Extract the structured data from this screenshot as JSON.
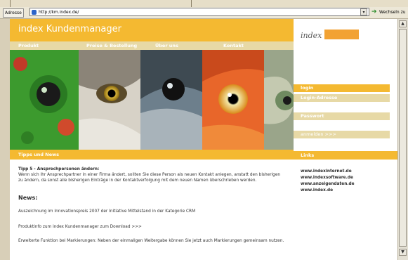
{
  "browser": {
    "address_label": "Adresse",
    "url": "http://km.index.de/",
    "go_label": "Wechseln zu"
  },
  "header": {
    "title": "index Kundenmanager",
    "logo_text": "index"
  },
  "nav": {
    "items": [
      "Produkt",
      "Preise & Bestellung",
      "Über uns",
      "Kontakt"
    ]
  },
  "content": {
    "section_label": "Tipps und News",
    "tip_title": "Tipp 5 - Ansprechpersonen ändern:",
    "tip_body": "Wenn sich Ihr Ansprechpartner in einer Firma ändert, sollten Sie diese Person als neuen Kontakt anlegen, anstatt den bisherigen zu ändern, da sonst alle bisherigen Einträge in der Kontaktverfolgung mit dem neuen Namen überschrieben werden.",
    "news_heading": "News:",
    "news": [
      "Auszeichnung im Innovationspreis 2007 der Initiative Mittelstand in der Kategorie CRM",
      "Produktinfo zum index Kundenmanager zum Download >>>",
      "Erweiterte Funktion bei Markierungen: Neben der einmaligen Weitergabe können Sie jetzt auch Markierungen gemeinsam nutzen."
    ]
  },
  "sidebar": {
    "login_label": "login",
    "login_address_label": "Login-Adresse",
    "password_label": "Passwort",
    "submit_label": "anmelden >>>",
    "links_label": "Links",
    "links": [
      "www.indexinternet.de",
      "www.indexsoftware.de",
      "www.anzeigendaten.de",
      "www.index.de"
    ]
  },
  "colors": {
    "accent": "#f4b931",
    "nav_bg": "#e7d9a6",
    "logo_orange": "#f2a233"
  }
}
